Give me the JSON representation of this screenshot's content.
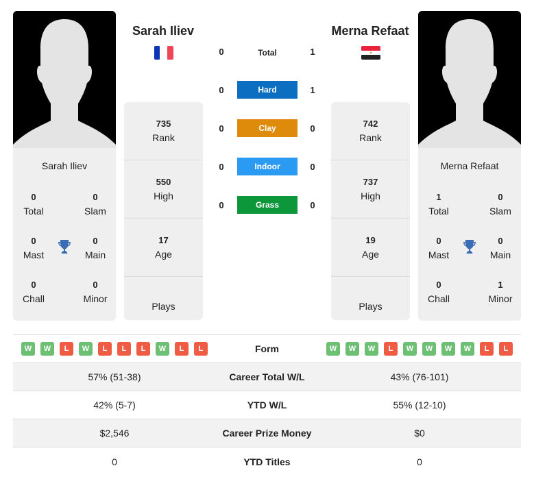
{
  "player1": {
    "name": "Sarah Iliev",
    "flag": "France",
    "flag_colors": [
      "#0d35b8",
      "#ffffff",
      "#ef4657"
    ],
    "rank": "735",
    "rank_label": "Rank",
    "high": "550",
    "high_label": "High",
    "age": "17",
    "age_label": "Age",
    "plays": "",
    "plays_label": "Plays",
    "titles": {
      "total": "0",
      "total_label": "Total",
      "slam": "0",
      "slam_label": "Slam",
      "mast": "0",
      "mast_label": "Mast",
      "main": "0",
      "main_label": "Main",
      "chall": "0",
      "chall_label": "Chall",
      "minor": "0",
      "minor_label": "Minor"
    },
    "form": [
      "W",
      "W",
      "L",
      "W",
      "L",
      "L",
      "L",
      "W",
      "L",
      "L"
    ]
  },
  "player2": {
    "name": "Merna Refaat",
    "flag": "Egypt",
    "flag_colors": [
      "#e8233b",
      "#ffffff",
      "#222222"
    ],
    "rank": "742",
    "rank_label": "Rank",
    "high": "737",
    "high_label": "High",
    "age": "19",
    "age_label": "Age",
    "plays": "",
    "plays_label": "Plays",
    "titles": {
      "total": "1",
      "total_label": "Total",
      "slam": "0",
      "slam_label": "Slam",
      "mast": "0",
      "mast_label": "Mast",
      "main": "0",
      "main_label": "Main",
      "chall": "0",
      "chall_label": "Chall",
      "minor": "1",
      "minor_label": "Minor"
    },
    "form": [
      "W",
      "W",
      "W",
      "L",
      "W",
      "W",
      "W",
      "W",
      "L",
      "L"
    ]
  },
  "h2h": [
    {
      "label": "Total",
      "p1": "0",
      "p2": "1",
      "color": ""
    },
    {
      "label": "Hard",
      "p1": "0",
      "p2": "1",
      "color": "#0b6ec0"
    },
    {
      "label": "Clay",
      "p1": "0",
      "p2": "0",
      "color": "#de8a0a"
    },
    {
      "label": "Indoor",
      "p1": "0",
      "p2": "0",
      "color": "#2b9af3"
    },
    {
      "label": "Grass",
      "p1": "0",
      "p2": "0",
      "color": "#0b973a"
    }
  ],
  "table": {
    "form_label": "Form",
    "rows": [
      {
        "label": "Career Total W/L",
        "p1": "57% (51-38)",
        "p2": "43% (76-101)"
      },
      {
        "label": "YTD W/L",
        "p1": "42% (5-7)",
        "p2": "55% (12-10)"
      },
      {
        "label": "Career Prize Money",
        "p1": "$2,546",
        "p2": "$0"
      },
      {
        "label": "YTD Titles",
        "p1": "0",
        "p2": "0"
      }
    ]
  },
  "colors": {
    "win": "#6dbf73",
    "loss": "#ef5b43",
    "trophy": "#3a6db5"
  }
}
